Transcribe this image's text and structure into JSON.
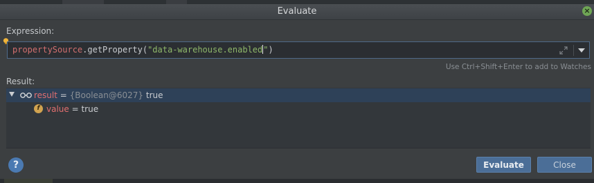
{
  "dialog": {
    "title": "Evaluate"
  },
  "expression": {
    "label": "Expression:",
    "tokens": {
      "object": "propertySource",
      "method": ".getProperty(",
      "string_open": "\"data-warehouse.enabled",
      "string_close": "\"",
      "close_paren": ")"
    },
    "hint": "Use Ctrl+Shift+Enter to add to Watches"
  },
  "result": {
    "label": "Result:",
    "rows": [
      {
        "name": "result",
        "eq": " = ",
        "type": "{Boolean@6027}",
        "value": " true"
      },
      {
        "name": "value",
        "eq": " = ",
        "value": "true"
      }
    ]
  },
  "buttons": {
    "help": "?",
    "evaluate": "Evaluate",
    "close": "Close"
  },
  "icons": {
    "bulb": "lightbulb-icon",
    "expand": "expand-icon",
    "dropdown": "chevron-down-icon",
    "watch": "glasses-icon",
    "field": "field-icon",
    "field_letter": "f",
    "close_window": "close-icon",
    "close_window_glyph": "×"
  },
  "colors": {
    "selection": "#2e4158",
    "button": "#4b6e97",
    "identifier": "#d26f6f",
    "string": "#8fb86a"
  }
}
